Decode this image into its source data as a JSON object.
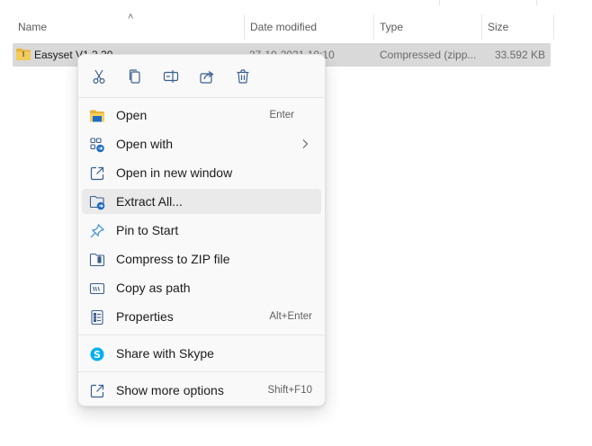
{
  "columns": {
    "name": "Name",
    "date_modified": "Date modified",
    "type": "Type",
    "size": "Size"
  },
  "file": {
    "name": "Easyset V1.3.20",
    "date": "27-10-2021 10:10",
    "type": "Compressed (zipp...",
    "size": "33.592 KB"
  },
  "quick_actions": [
    "cut-icon",
    "copy-icon",
    "rename-icon",
    "share-icon",
    "delete-icon"
  ],
  "menu": {
    "items": [
      {
        "label": "Open",
        "shortcut": "Enter",
        "icon": "folder-icon"
      },
      {
        "label": "Open with",
        "shortcut": "",
        "icon": "open-with-icon"
      },
      {
        "label": "Open in new window",
        "shortcut": "",
        "icon": "new-window-icon"
      },
      {
        "label": "Extract All...",
        "shortcut": "",
        "icon": "extract-icon"
      },
      {
        "label": "Pin to Start",
        "shortcut": "",
        "icon": "pin-icon"
      },
      {
        "label": "Compress to ZIP file",
        "shortcut": "",
        "icon": "zip-folder-icon"
      },
      {
        "label": "Copy as path",
        "shortcut": "",
        "icon": "copy-path-icon"
      },
      {
        "label": "Properties",
        "shortcut": "Alt+Enter",
        "icon": "properties-icon"
      },
      {
        "label": "Share with Skype",
        "shortcut": "",
        "icon": "skype-icon"
      },
      {
        "label": "Show more options",
        "shortcut": "Shift+F10",
        "icon": "more-options-icon"
      }
    ]
  },
  "colors": {
    "accent": "#0f6cbd",
    "selection": "#d9d9d9",
    "menu_bg": "#f9f9f9",
    "hover": "#eaeaea",
    "skype": "#00aff0",
    "folder": "#f2c14e"
  }
}
